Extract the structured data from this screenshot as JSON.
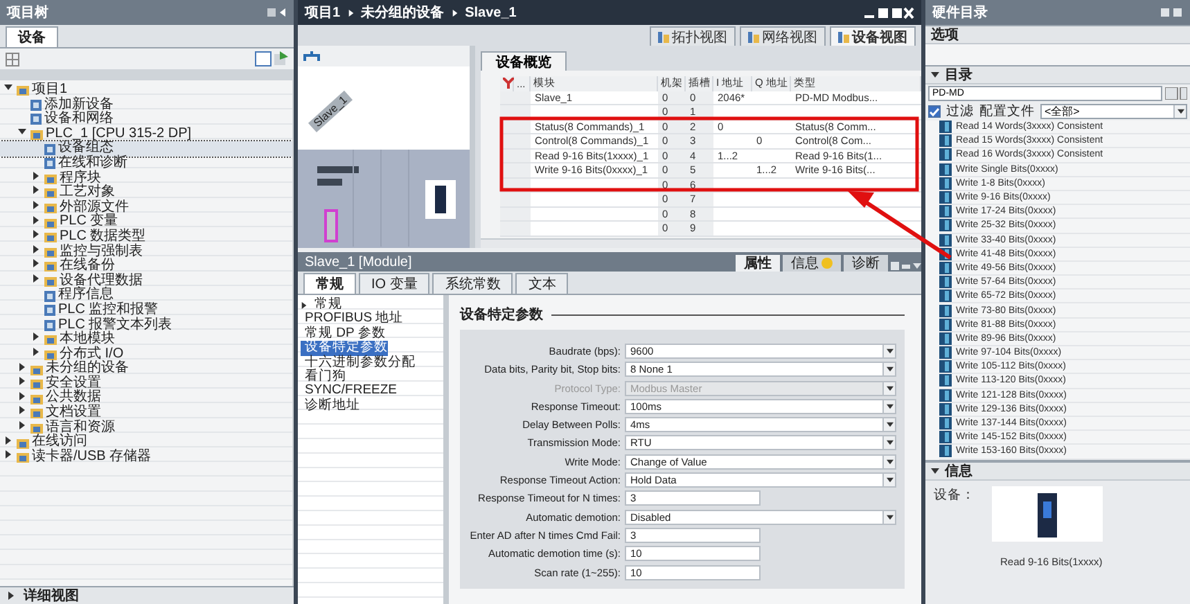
{
  "project_tree": {
    "title": "项目树",
    "tab": "设备",
    "items": [
      {
        "label": "项目1",
        "kind": "branch",
        "expanded": true,
        "selected": false,
        "children": [
          {
            "label": "添加新设备",
            "kind": "leaf",
            "selected": false
          },
          {
            "label": "设备和网络",
            "kind": "leaf",
            "selected": false
          },
          {
            "label": "PLC_1 [CPU 315-2 DP]",
            "kind": "branch",
            "expanded": true,
            "selected": false,
            "children": [
              {
                "label": "设备组态",
                "kind": "leaf",
                "selected": true
              },
              {
                "label": "在线和诊断",
                "kind": "leaf",
                "selected": false
              },
              {
                "label": "程序块",
                "kind": "branch",
                "expanded": false,
                "selected": false
              },
              {
                "label": "工艺对象",
                "kind": "branch",
                "expanded": false,
                "selected": false
              },
              {
                "label": "外部源文件",
                "kind": "branch",
                "expanded": false,
                "selected": false
              },
              {
                "label": "PLC 变量",
                "kind": "branch",
                "expanded": false,
                "selected": false
              },
              {
                "label": "PLC 数据类型",
                "kind": "branch",
                "expanded": false,
                "selected": false
              },
              {
                "label": "监控与强制表",
                "kind": "branch",
                "expanded": false,
                "selected": false
              },
              {
                "label": "在线备份",
                "kind": "branch",
                "expanded": false,
                "selected": false
              },
              {
                "label": "设备代理数据",
                "kind": "branch",
                "expanded": false,
                "selected": false
              },
              {
                "label": "程序信息",
                "kind": "leaf",
                "selected": false
              },
              {
                "label": "PLC 监控和报警",
                "kind": "leaf",
                "selected": false
              },
              {
                "label": "PLC 报警文本列表",
                "kind": "leaf",
                "selected": false
              },
              {
                "label": "本地模块",
                "kind": "branch",
                "expanded": false,
                "selected": false
              },
              {
                "label": "分布式 I/O",
                "kind": "branch",
                "expanded": false,
                "selected": false
              }
            ]
          },
          {
            "label": "未分组的设备",
            "kind": "branch",
            "expanded": false,
            "selected": false
          },
          {
            "label": "安全设置",
            "kind": "branch",
            "expanded": false,
            "selected": false
          },
          {
            "label": "公共数据",
            "kind": "branch",
            "expanded": false,
            "selected": false
          },
          {
            "label": "文档设置",
            "kind": "branch",
            "expanded": false,
            "selected": false
          },
          {
            "label": "语言和资源",
            "kind": "branch",
            "expanded": false,
            "selected": false
          }
        ]
      },
      {
        "label": "在线访问",
        "kind": "branch",
        "expanded": false,
        "selected": false
      },
      {
        "label": "读卡器/USB 存储器",
        "kind": "branch",
        "expanded": false,
        "selected": false
      }
    ],
    "details": "详细视图"
  },
  "editor": {
    "breadcrumb": [
      "项目1",
      "未分组的设备",
      "Slave_1"
    ],
    "view_tabs": [
      {
        "label": "拓扑视图",
        "selected": false
      },
      {
        "label": "网络视图",
        "selected": false
      },
      {
        "label": "设备视图",
        "selected": true
      }
    ],
    "canvas_label": "Slave_1",
    "overview_tab": "设备概览",
    "columns": [
      "...",
      "模块",
      "机架",
      "插槽",
      "I 地址",
      "Q 地址",
      "类型"
    ],
    "rows": [
      {
        "module": "Slave_1",
        "rack": "0",
        "slot": "0",
        "i_address": "2046*",
        "type": "PD-MD Modbus..."
      },
      {
        "rack": "0",
        "slot": "1"
      },
      {
        "module": "Status(8 Commands)_1",
        "rack": "0",
        "slot": "2",
        "i_address": "0",
        "type": "Status(8 Comm..."
      },
      {
        "module": "Control(8 Commands)_1",
        "rack": "0",
        "slot": "3",
        "q_address": "0",
        "type": "Control(8 Com..."
      },
      {
        "module": "Read 9-16 Bits(1xxxx)_1",
        "rack": "0",
        "slot": "4",
        "i_address": "1...2",
        "type": "Read 9-16 Bits(1..."
      },
      {
        "module": "Write 9-16 Bits(0xxxx)_1",
        "rack": "0",
        "slot": "5",
        "q_address": "1...2",
        "type": "Write 9-16 Bits(..."
      },
      {
        "rack": "0",
        "slot": "6"
      },
      {
        "rack": "0",
        "slot": "7"
      },
      {
        "rack": "0",
        "slot": "8"
      },
      {
        "rack": "0",
        "slot": "9"
      }
    ]
  },
  "properties": {
    "title": "Slave_1 [Module]",
    "tabs": [
      {
        "label": "属性",
        "selected": true
      },
      {
        "label": "信息",
        "selected": false
      },
      {
        "label": "诊断",
        "selected": false
      }
    ],
    "subtabs": [
      {
        "label": "常规",
        "selected": true
      },
      {
        "label": "IO 变量",
        "selected": false
      },
      {
        "label": "系统常数",
        "selected": false
      },
      {
        "label": "文本",
        "selected": false
      }
    ],
    "nav": [
      {
        "label": "常规",
        "selected": false
      },
      {
        "label": "PROFIBUS 地址",
        "selected": false
      },
      {
        "label": "常规 DP 参数",
        "selected": false
      },
      {
        "label": "设备特定参数",
        "selected": true
      },
      {
        "label": "十六进制参数分配",
        "selected": false
      },
      {
        "label": "看门狗",
        "selected": false
      },
      {
        "label": "SYNC/FREEZE",
        "selected": false
      },
      {
        "label": "诊断地址",
        "selected": false
      }
    ],
    "section": "设备特定参数",
    "params": [
      {
        "label": "Baudrate (bps):",
        "value": "9600",
        "kind": "dropdown",
        "disabled": false
      },
      {
        "label": "Data bits, Parity bit, Stop bits:",
        "value": "8 None 1",
        "kind": "dropdown",
        "disabled": false
      },
      {
        "label": "Protocol Type:",
        "value": "Modbus Master",
        "kind": "dropdown",
        "disabled": true
      },
      {
        "label": "Response Timeout:",
        "value": "100ms",
        "kind": "dropdown",
        "disabled": false
      },
      {
        "label": "Delay Between Polls:",
        "value": "4ms",
        "kind": "dropdown",
        "disabled": false
      },
      {
        "label": "Transmission Mode:",
        "value": "RTU",
        "kind": "dropdown",
        "disabled": false
      },
      {
        "label": "Write Mode:",
        "value": "Change of Value",
        "kind": "dropdown",
        "disabled": false
      },
      {
        "label": "Response Timeout Action:",
        "value": "Hold Data",
        "kind": "dropdown",
        "disabled": false
      },
      {
        "label": "Response Timeout for N times:",
        "value": "3",
        "kind": "input",
        "disabled": false
      },
      {
        "label": "Automatic demotion:",
        "value": "Disabled",
        "kind": "dropdown",
        "disabled": false
      },
      {
        "label": "Enter AD after N times Cmd Fail:",
        "value": "3",
        "kind": "input",
        "disabled": false
      },
      {
        "label": "Automatic demotion time (s):",
        "value": "10",
        "kind": "input",
        "disabled": false
      },
      {
        "label": "Scan rate (1~255):",
        "value": "10",
        "kind": "input",
        "disabled": false
      }
    ]
  },
  "catalog": {
    "title": "硬件目录",
    "options": "选项",
    "section": "目录",
    "search": "PD-MD",
    "filter": {
      "label": "过滤",
      "checked": true
    },
    "profile_label": "配置文件",
    "profile": "<全部>",
    "items": [
      "Read 14 Words(3xxxx) Consistent",
      "Read 15 Words(3xxxx) Consistent",
      "Read 16 Words(3xxxx) Consistent",
      "Write Single Bits(0xxxx)",
      "Write 1-8 Bits(0xxxx)",
      "Write 9-16 Bits(0xxxx)",
      "Write 17-24 Bits(0xxxx)",
      "Write 25-32 Bits(0xxxx)",
      "Write 33-40 Bits(0xxxx)",
      "Write 41-48 Bits(0xxxx)",
      "Write 49-56 Bits(0xxxx)",
      "Write 57-64 Bits(0xxxx)",
      "Write 65-72 Bits(0xxxx)",
      "Write 73-80 Bits(0xxxx)",
      "Write 81-88 Bits(0xxxx)",
      "Write 89-96 Bits(0xxxx)",
      "Write 97-104 Bits(0xxxx)",
      "Write 105-112 Bits(0xxxx)",
      "Write 113-120 Bits(0xxxx)",
      "Write 121-128 Bits(0xxxx)",
      "Write 129-136 Bits(0xxxx)",
      "Write 137-144 Bits(0xxxx)",
      "Write 145-152 Bits(0xxxx)",
      "Write 153-160 Bits(0xxxx)"
    ],
    "info_section": "信息",
    "device_label": "设备：",
    "device_caption": "Read 9-16 Bits(1xxxx)"
  }
}
